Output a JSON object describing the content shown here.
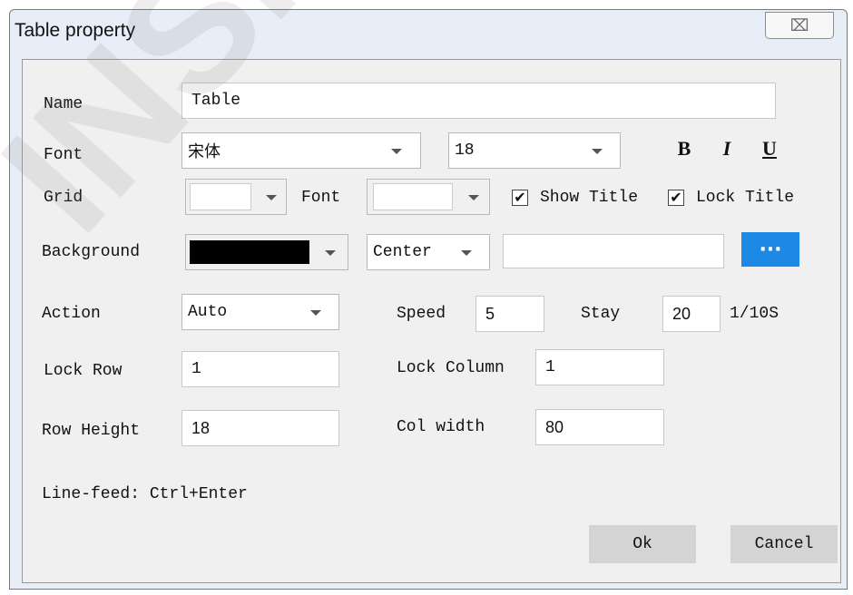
{
  "window": {
    "title": "Table property",
    "close_glyph": "⌧"
  },
  "fields": {
    "name": {
      "label": "Name",
      "value": "Table"
    },
    "font": {
      "label": "Font",
      "family": "宋体",
      "size": "18",
      "bold": "B",
      "italic": "I",
      "underline": "U"
    },
    "grid": {
      "label": "Grid",
      "font_label": "Font"
    },
    "show_title": {
      "label": "Show Title",
      "checked": "✔"
    },
    "lock_title": {
      "label": "Lock Title",
      "checked": "✔"
    },
    "background": {
      "label": "Background",
      "align": "Center",
      "path": "",
      "color": "#000000",
      "browse": "···"
    },
    "action": {
      "label": "Action",
      "value": "Auto"
    },
    "speed": {
      "label": "Speed",
      "value": "5"
    },
    "stay": {
      "label": "Stay",
      "value": "20",
      "unit": "1/10S"
    },
    "lock_row": {
      "label": "Lock Row",
      "value": "1"
    },
    "lock_column": {
      "label": "Lock Column",
      "value": "1"
    },
    "row_height": {
      "label": "Row Height",
      "value": "18"
    },
    "col_width": {
      "label": "Col width",
      "value": "80"
    },
    "hint": "Line-feed: Ctrl+Enter"
  },
  "buttons": {
    "ok": "Ok",
    "cancel": "Cancel"
  },
  "watermark": "INSN TECH"
}
